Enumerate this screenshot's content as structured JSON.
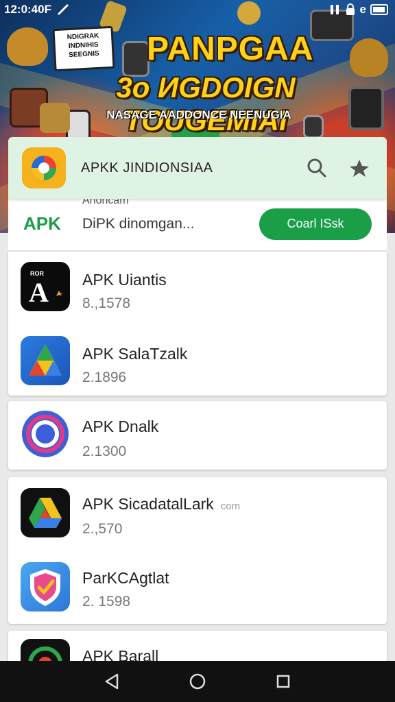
{
  "status_bar": {
    "time": "12:0:40F",
    "right_text": "e"
  },
  "banner": {
    "note_text": "NDIGRAK INDNIHIS SEEGNIS",
    "title_line1": "PANPGAA",
    "title_line2": "3o ИGDOIGN TOUGEMIAI",
    "subtitle": "NASAGE AADDONCE NEENUGIA"
  },
  "search": {
    "title": "APKK JINDIONSIAA",
    "icons": [
      "search-icon",
      "share-icon"
    ]
  },
  "apk_row": {
    "label": "APK",
    "ghost_text": "Ahoncam",
    "text": "DiPK dinomgan...",
    "button": "Coarl ISsk"
  },
  "apps": [
    {
      "name": "APK Uiantis",
      "version": "8.,1578",
      "icon": "apk-a-icon",
      "tag": "ROR"
    },
    {
      "name": "APK SalaTzalk",
      "version": "2.1896",
      "icon": "triangle-app-icon"
    },
    {
      "name": "APK Dnalk",
      "version": "2.1300",
      "icon": "ring-app-icon"
    },
    {
      "name": "APK SicadatalLark",
      "extra": "com",
      "version": "2.,570",
      "icon": "drive-app-icon"
    },
    {
      "name": "ParKCAgtlat",
      "version": "2. 1598",
      "icon": "shield-app-icon"
    },
    {
      "name": "APK Barall",
      "version": "",
      "icon": "circle-app-icon"
    }
  ],
  "colors": {
    "accent_green": "#1a9e47",
    "header_bg": "#dff3e4",
    "banner_yellow": "#ffd21a"
  }
}
